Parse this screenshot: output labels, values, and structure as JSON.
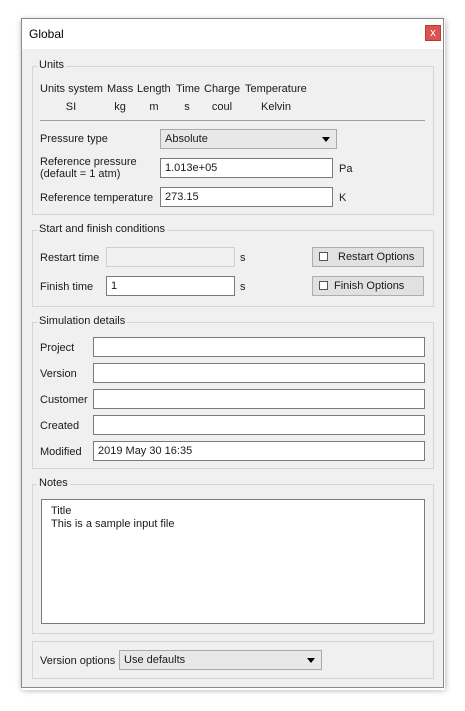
{
  "window": {
    "title": "Global",
    "close_label": "x"
  },
  "units": {
    "legend": "Units",
    "headers": [
      "Units system",
      "Mass",
      "Length",
      "Time",
      "Charge",
      "Temperature"
    ],
    "values": [
      "SI",
      "kg",
      "m",
      "s",
      "coul",
      "Kelvin"
    ],
    "pressure_type_label": "Pressure type",
    "pressure_type_value": "Absolute",
    "ref_pressure_label_1": "Reference pressure",
    "ref_pressure_label_2": "(default = 1 atm)",
    "ref_pressure_value": "1.013e+05",
    "ref_pressure_unit": "Pa",
    "ref_temp_label": "Reference temperature",
    "ref_temp_value": "273.15",
    "ref_temp_unit": "K"
  },
  "start_finish": {
    "legend": "Start and finish conditions",
    "restart_label": "Restart time",
    "restart_value": "",
    "restart_unit": "s",
    "restart_options": "Restart Options",
    "finish_label": "Finish time",
    "finish_value": "1",
    "finish_unit": "s",
    "finish_options": "Finish Options"
  },
  "simulation": {
    "legend": "Simulation details",
    "project_label": "Project",
    "project_value": "",
    "version_label": "Version",
    "version_value": "",
    "customer_label": "Customer",
    "customer_value": "",
    "created_label": "Created",
    "created_value": "",
    "modified_label": "Modified",
    "modified_value": "2019 May 30 16:35"
  },
  "notes": {
    "legend": "Notes",
    "text": "Title\nThis is a sample input file"
  },
  "version_options": {
    "label": "Version options",
    "value": "Use defaults"
  }
}
